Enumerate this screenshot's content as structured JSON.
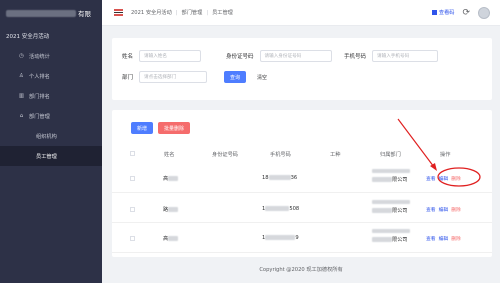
{
  "sidebar": {
    "brand_suffix": "有限",
    "top_item": "2021 安全月活动",
    "items": [
      {
        "icon": "clock-icon",
        "glyph": "◷",
        "label": "活动统计"
      },
      {
        "icon": "person-icon",
        "glyph": "♙",
        "label": "个人排名"
      },
      {
        "icon": "bar-chart-icon",
        "glyph": "▥",
        "label": "部门排名"
      },
      {
        "icon": "home-icon",
        "glyph": "⌂",
        "label": "部门管理"
      }
    ],
    "subitems": [
      {
        "label": "组织机构",
        "active": false
      },
      {
        "label": "员工管理",
        "active": true
      }
    ]
  },
  "header": {
    "crumbs": [
      "2021 安全月活动",
      "部门管理",
      "员工管理"
    ],
    "qr_label": "查看码"
  },
  "search": {
    "name_label": "姓名",
    "name_placeholder": "请输入姓名",
    "id_label": "身份证号码",
    "id_placeholder": "请输入身份证号码",
    "phone_label": "手机号码",
    "phone_placeholder": "请输入手机号码",
    "dept_label": "部门",
    "dept_placeholder": "请点击选择部门",
    "query_label": "查询",
    "clear_label": "清空"
  },
  "table": {
    "add_label": "新增",
    "batch_delete_label": "批量删除",
    "columns": [
      "姓名",
      "身份证号码",
      "手机号码",
      "工种",
      "归属部门",
      "操作"
    ],
    "rows": [
      {
        "name": "高",
        "phone_prefix": "18",
        "phone_suffix": "36",
        "dept_suffix": "限公司"
      },
      {
        "name": "路",
        "phone_prefix": "1",
        "phone_suffix": "508",
        "dept_suffix": "限公司"
      },
      {
        "name": "高",
        "phone_prefix": "1",
        "phone_suffix": "9",
        "dept_suffix": "限公司"
      }
    ],
    "op_view": "查看",
    "op_edit": "编辑",
    "op_delete": "删除"
  },
  "footer": {
    "copyright": "Copyright @2020 现工加德权所有"
  },
  "colors": {
    "sidebar_bg": "#2d3147",
    "primary": "#4e7dff",
    "danger": "#f56c6c",
    "annotation": "#e02020"
  }
}
